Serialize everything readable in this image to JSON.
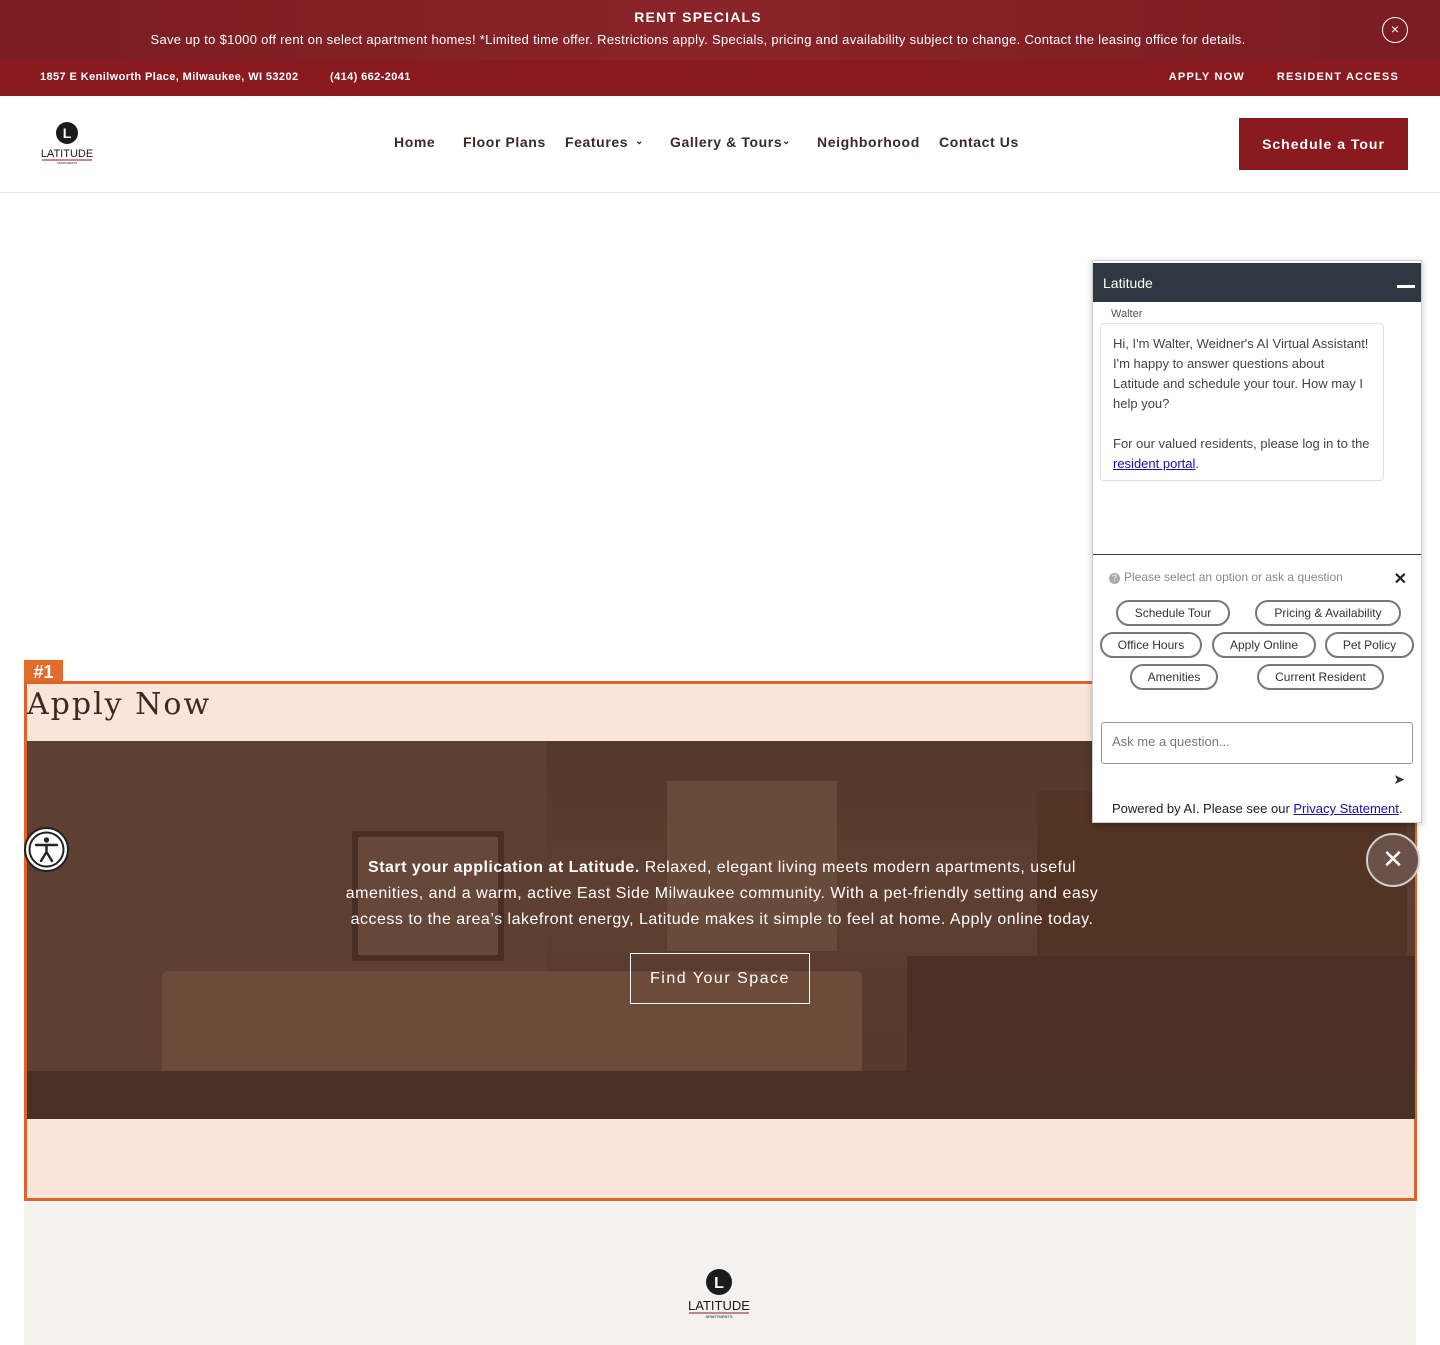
{
  "specials": {
    "title": "RENT SPECIALS",
    "text": "Save up to $1000 off rent on select apartment homes! *Limited time offer. Restrictions apply. Specials, pricing and availability subject to change. Contact the leasing office for details.",
    "close_icon": "×"
  },
  "infobar": {
    "address": "1857 E Kenilworth Place, Milwaukee, WI 53202",
    "phone": "(414) 662-2041",
    "apply": "APPLY NOW",
    "resident": "RESIDENT ACCESS"
  },
  "header": {
    "logo_text": "LATITUDE",
    "logo_sub": "APARTMENTS",
    "logo_letter": "L",
    "nav": {
      "home": "Home",
      "floor_plans": "Floor Plans",
      "features": "Features",
      "gallery": "Gallery & Tours",
      "neighborhood": "Neighborhood",
      "contact": "Contact Us"
    },
    "tour_button": "Schedule a Tour"
  },
  "section": {
    "label": "#1",
    "heading": "Apply Now",
    "intro_bold": "Start your application at Latitude.",
    "intro_rest": " Relaxed, elegant living meets modern apartments, useful amenities, and a warm, active East Side Milwaukee community. With a pet-friendly setting and easy access to the area’s lakefront energy, Latitude makes it simple to feel at home. Apply online today.",
    "cta": "Find Your Space"
  },
  "chat": {
    "title": "Latitude",
    "sender": "Walter",
    "message1": "Hi, I'm Walter, Weidner's AI Virtual Assistant! I'm happy to answer questions about Latitude and schedule your tour. How may I help you?",
    "message2_prefix": "For our valued residents, please log in to the ",
    "message2_link": "resident portal",
    "message2_suffix": ".",
    "prompt": "Please select an option or ask a question",
    "options": {
      "schedule_tour": "Schedule Tour",
      "pricing": "Pricing & Availability",
      "office_hours": "Office Hours",
      "apply_online": "Apply Online",
      "pet_policy": "Pet Policy",
      "amenities": "Amenities",
      "current_resident": "Current Resident"
    },
    "input_placeholder": "Ask me a question...",
    "powered_prefix": "Powered by AI. Please see our ",
    "powered_link": "Privacy Statement",
    "powered_suffix": "."
  }
}
